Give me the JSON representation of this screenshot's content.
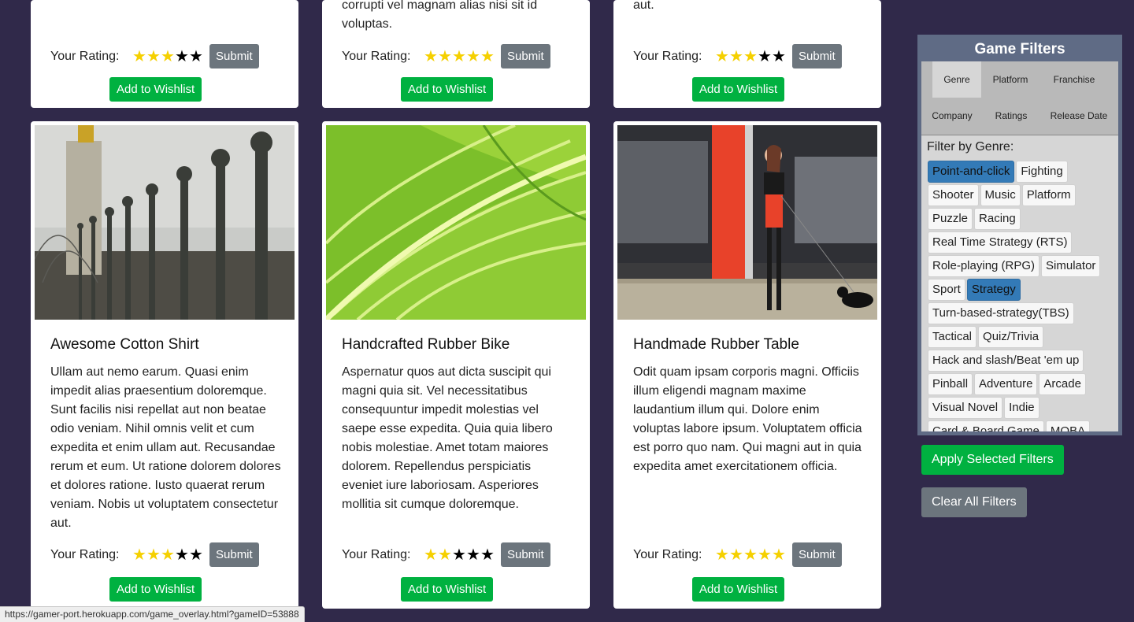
{
  "top_row": {
    "cards": [
      {
        "desc_fragment": "",
        "rating_label": "Your Rating:",
        "stars": [
          1,
          1,
          1,
          0,
          0
        ],
        "submit": "Submit",
        "wishlist": "Add to Wishlist"
      },
      {
        "desc_fragment": "corrupti vel magnam alias nisi sit id voluptas.",
        "rating_label": "Your Rating:",
        "stars": [
          1,
          1,
          1,
          1,
          1
        ],
        "submit": "Submit",
        "wishlist": "Add to Wishlist"
      },
      {
        "desc_fragment": "aut.",
        "rating_label": "Your Rating:",
        "stars": [
          1,
          1,
          1,
          0,
          0
        ],
        "submit": "Submit",
        "wishlist": "Add to Wishlist"
      }
    ]
  },
  "games": [
    {
      "title": "Awesome Cotton Shirt",
      "description": "Ullam aut nemo earum. Quasi enim impedit alias praesentium doloremque. Sunt facilis nisi repellat aut non beatae odio veniam. Nihil omnis velit et cum expedita et enim ullam aut. Recusandae rerum et eum. Ut ratione dolorem dolores et dolores ratione. Iusto quaerat rerum veniam. Nobis ut voluptatem consectetur aut.",
      "rating_label": "Your Rating:",
      "stars": [
        1,
        1,
        1,
        0,
        0
      ],
      "submit": "Submit",
      "wishlist": "Add to Wishlist"
    },
    {
      "title": "Handcrafted Rubber Bike",
      "description": "Aspernatur quos aut dicta suscipit qui magni quia sit. Vel necessitatibus consequuntur impedit molestias vel saepe esse expedita. Quia quia libero nobis molestiae. Amet totam maiores dolorem. Repellendus perspiciatis eveniet iure laboriosam. Asperiores mollitia sit cumque doloremque.",
      "rating_label": "Your Rating:",
      "stars": [
        1,
        1,
        0,
        0,
        0
      ],
      "submit": "Submit",
      "wishlist": "Add to Wishlist"
    },
    {
      "title": "Handmade Rubber Table",
      "description": "Odit quam ipsam corporis magni. Officiis illum eligendi magnam maxime laudantium illum qui. Dolore enim voluptas labore ipsum. Voluptatem officia est porro quo nam. Qui magni aut in quia expedita amet exercitationem officia.",
      "rating_label": "Your Rating:",
      "stars": [
        1,
        1,
        1,
        1,
        1
      ],
      "submit": "Submit",
      "wishlist": "Add to Wishlist"
    }
  ],
  "filters": {
    "title": "Game Filters",
    "tabs": [
      "Genre",
      "Platform",
      "Franchise",
      "Company",
      "Ratings",
      "Release Date"
    ],
    "active_tab": "Genre",
    "filter_label": "Filter by Genre:",
    "genres": [
      {
        "label": "Point-and-click",
        "selected": true
      },
      {
        "label": "Fighting",
        "selected": false
      },
      {
        "label": "Shooter",
        "selected": false
      },
      {
        "label": "Music",
        "selected": false
      },
      {
        "label": "Platform",
        "selected": false
      },
      {
        "label": "Puzzle",
        "selected": false
      },
      {
        "label": "Racing",
        "selected": false
      },
      {
        "label": "Real Time Strategy (RTS)",
        "selected": false
      },
      {
        "label": "Role-playing (RPG)",
        "selected": false
      },
      {
        "label": "Simulator",
        "selected": false
      },
      {
        "label": "Sport",
        "selected": false
      },
      {
        "label": "Strategy",
        "selected": true
      },
      {
        "label": "Turn-based-strategy(TBS)",
        "selected": false
      },
      {
        "label": "Tactical",
        "selected": false
      },
      {
        "label": "Quiz/Trivia",
        "selected": false
      },
      {
        "label": "Hack and slash/Beat 'em up",
        "selected": false
      },
      {
        "label": "Pinball",
        "selected": false
      },
      {
        "label": "Adventure",
        "selected": false
      },
      {
        "label": "Arcade",
        "selected": false
      },
      {
        "label": "Visual Novel",
        "selected": false
      },
      {
        "label": "Indie",
        "selected": false
      },
      {
        "label": "Card & Board Game",
        "selected": false
      },
      {
        "label": "MOBA",
        "selected": false
      }
    ],
    "apply": "Apply Selected Filters",
    "clear": "Clear All Filters"
  },
  "status_bar": "https://gamer-port.herokuapp.com/game_overlay.html?gameID=53888",
  "colors": {
    "background": "#30294a",
    "wishlist": "#00b140",
    "submit": "#6c757d",
    "star": "#f5d000",
    "chip_selected": "#337ab7"
  }
}
